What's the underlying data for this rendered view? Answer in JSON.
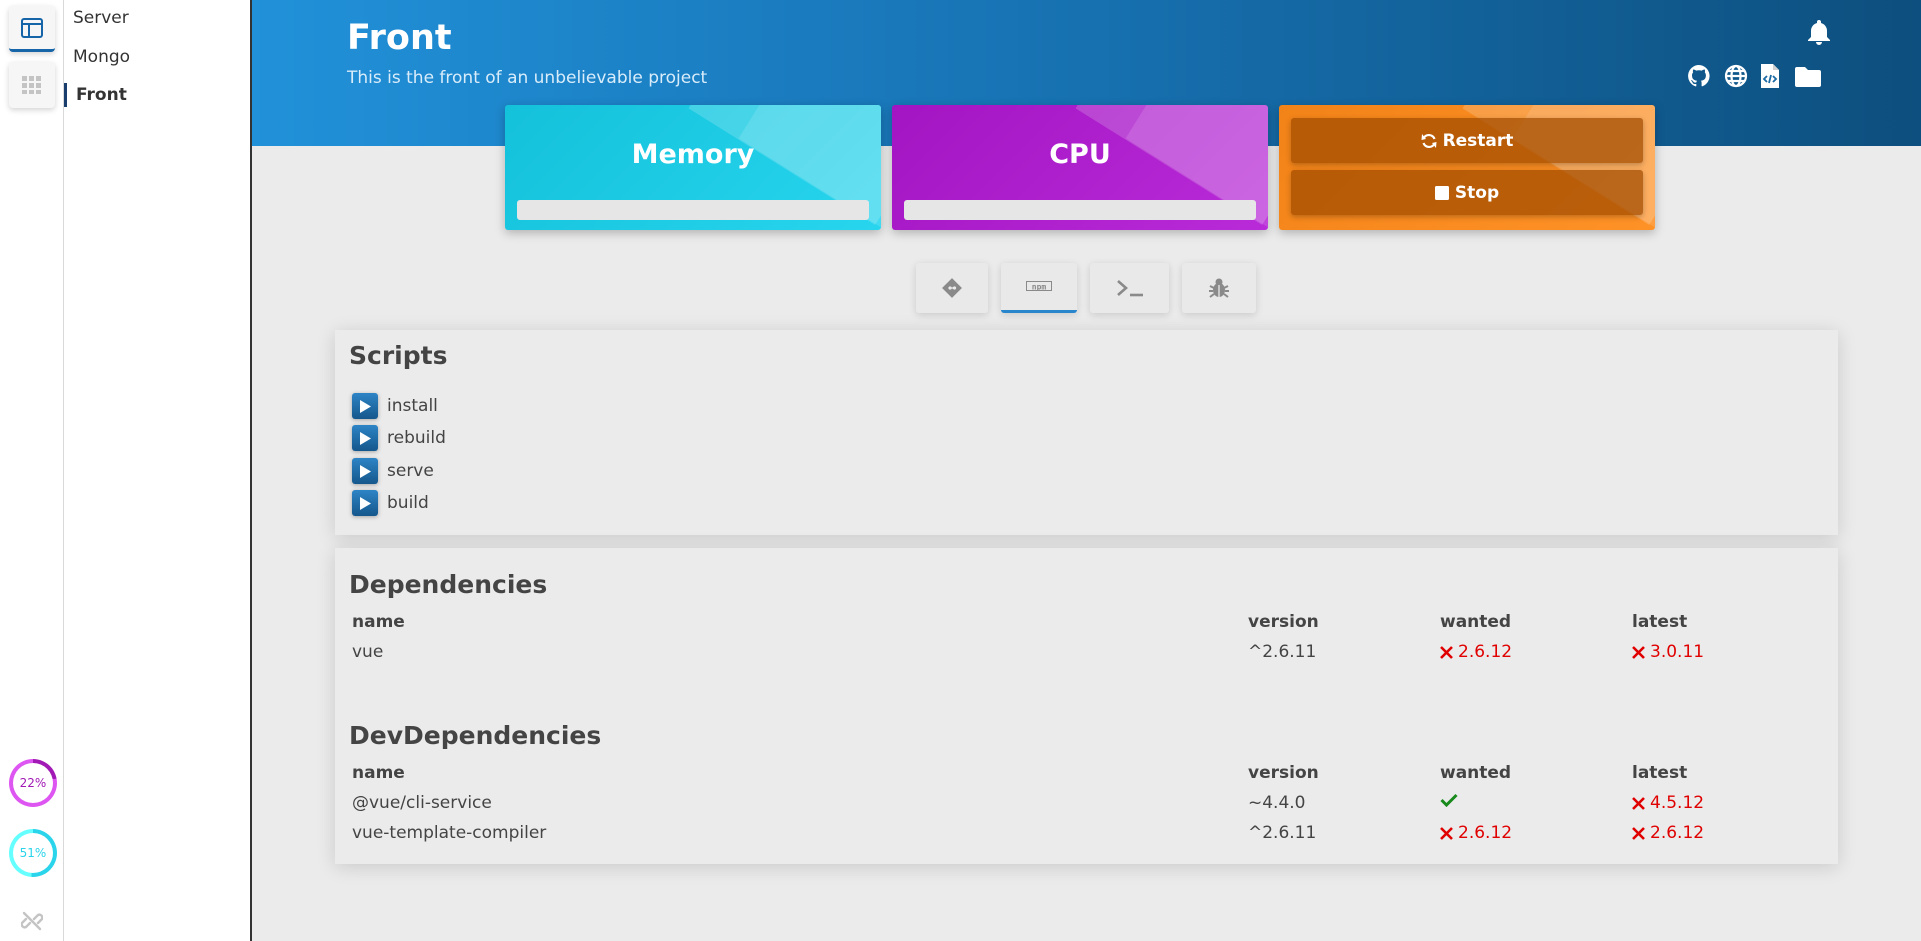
{
  "sidebar": {
    "projects": [
      {
        "label": "Server"
      },
      {
        "label": "Mongo"
      },
      {
        "label": "Front"
      }
    ],
    "cpu_ring": {
      "label": "22%",
      "value": 22,
      "color": "#a21ab5"
    },
    "memory_ring": {
      "label": "51%",
      "value": 51,
      "color": "#2ad4ea"
    }
  },
  "header": {
    "title": "Front",
    "subtitle": "This is the front of an unbelievable project"
  },
  "cards": {
    "memory": {
      "title": "Memory",
      "color": "#1ecbe4",
      "fill": 0
    },
    "cpu": {
      "title": "CPU",
      "color": "#ad1fcc",
      "fill": 0
    },
    "controls": {
      "color": "#f7881d",
      "restart_label": "Restart",
      "stop_label": "Stop"
    }
  },
  "tabs": [
    {
      "icon": "git-icon"
    },
    {
      "icon": "npm-icon",
      "text": "npm",
      "active": true
    },
    {
      "icon": "terminal-icon"
    },
    {
      "icon": "bug-icon"
    }
  ],
  "scripts": {
    "title": "Scripts",
    "items": [
      {
        "name": "install"
      },
      {
        "name": "rebuild"
      },
      {
        "name": "serve"
      },
      {
        "name": "build"
      }
    ]
  },
  "dependencies": {
    "title": "Dependencies",
    "columns": [
      "name",
      "version",
      "wanted",
      "latest"
    ],
    "rows": [
      {
        "name": "vue",
        "version": "^2.6.11",
        "wanted": "2.6.12",
        "wanted_ok": false,
        "latest": "3.0.11",
        "latest_ok": false
      }
    ]
  },
  "devDependencies": {
    "title": "DevDependencies",
    "columns": [
      "name",
      "version",
      "wanted",
      "latest"
    ],
    "rows": [
      {
        "name": "@vue/cli-service",
        "version": "~4.4.0",
        "wanted": "",
        "wanted_ok": true,
        "latest": "4.5.12",
        "latest_ok": false
      },
      {
        "name": "vue-template-compiler",
        "version": "^2.6.11",
        "wanted": "2.6.12",
        "wanted_ok": false,
        "latest": "2.6.12",
        "latest_ok": false
      }
    ]
  }
}
